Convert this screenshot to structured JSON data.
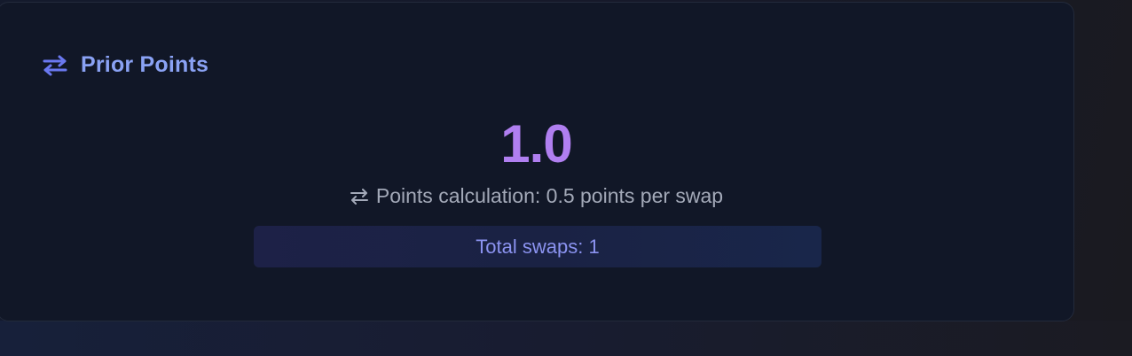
{
  "card": {
    "title": "Prior Points",
    "title_icon": "swap-arrows-icon",
    "points_value": "1.0",
    "calculation_icon": "swap-arrows-icon",
    "calculation_text": "Points calculation: 0.5 points per swap",
    "total_swaps_text": "Total swaps: 1"
  },
  "colors": {
    "accent_title": "#8aa2f4",
    "accent_icon": "#6a78f0",
    "points_value": "#b07ff0",
    "card_background": "#111727",
    "swaps_bar_text": "#8b93f0"
  }
}
